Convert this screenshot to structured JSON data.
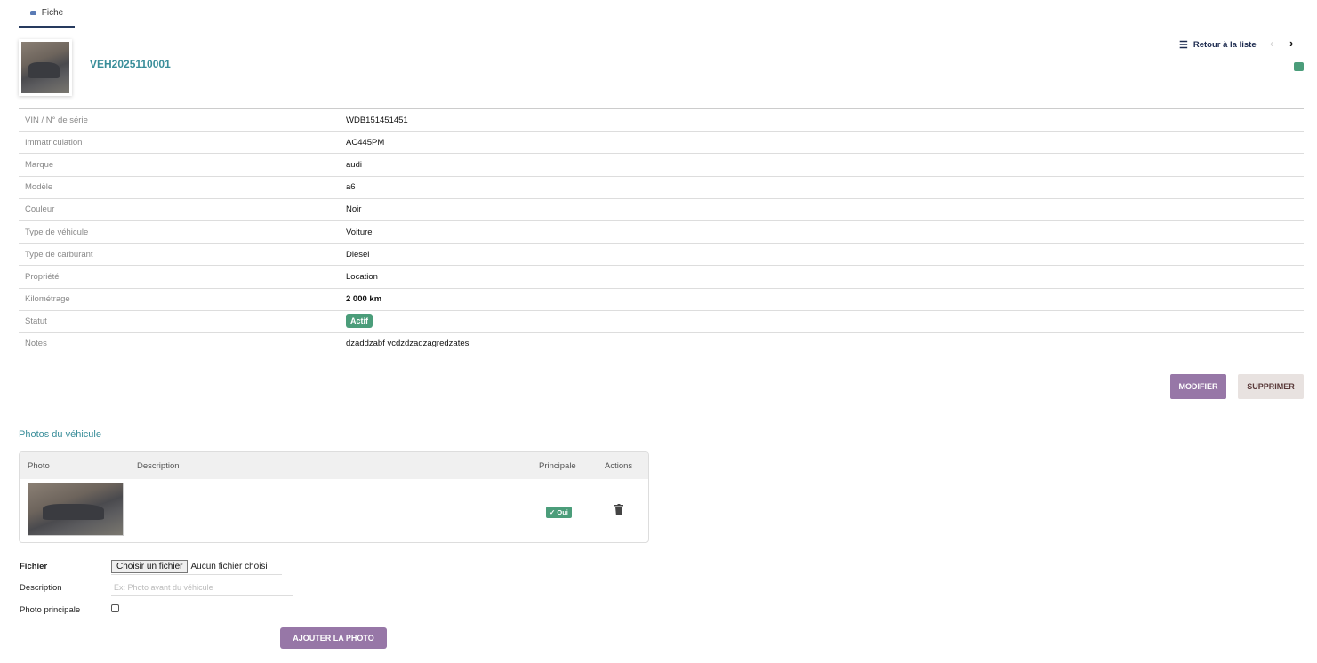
{
  "tab": {
    "label": "Fiche"
  },
  "vehicle": {
    "title": "VEH2025110001"
  },
  "nav": {
    "back_label": "Retour à la liste"
  },
  "fields": [
    {
      "label": "VIN / N° de série",
      "value": "WDB151451451"
    },
    {
      "label": "Immatriculation",
      "value": "AC445PM"
    },
    {
      "label": "Marque",
      "value": "audi"
    },
    {
      "label": "Modèle",
      "value": "a6"
    },
    {
      "label": "Couleur",
      "value": "Noir"
    },
    {
      "label": "Type de véhicule",
      "value": "Voiture"
    },
    {
      "label": "Type de carburant",
      "value": "Diesel"
    },
    {
      "label": "Propriété",
      "value": "Location"
    },
    {
      "label": "Kilométrage",
      "value": "2 000 km"
    },
    {
      "label": "Statut",
      "value": "Actif"
    },
    {
      "label": "Notes",
      "value": "dzaddzabf vcdzdzadzagredzates"
    }
  ],
  "actions": {
    "modify": "MODIFIER",
    "delete": "SUPPRIMER"
  },
  "photos": {
    "title": "Photos du véhicule",
    "headers": {
      "photo": "Photo",
      "description": "Description",
      "principal": "Principale",
      "actions": "Actions"
    },
    "rows": [
      {
        "description": "",
        "principal": "✓ Oui"
      }
    ]
  },
  "form": {
    "file_label": "Fichier",
    "file_button": "Choisir un fichier",
    "file_status": "Aucun fichier choisi",
    "desc_label": "Description",
    "desc_placeholder": "Ex: Photo avant du véhicule",
    "principal_label": "Photo principale",
    "submit": "AJOUTER LA PHOTO"
  },
  "colors": {
    "accent": "#3a8e9a",
    "success": "#4b9d7a",
    "primary_btn": "#9777a7"
  }
}
